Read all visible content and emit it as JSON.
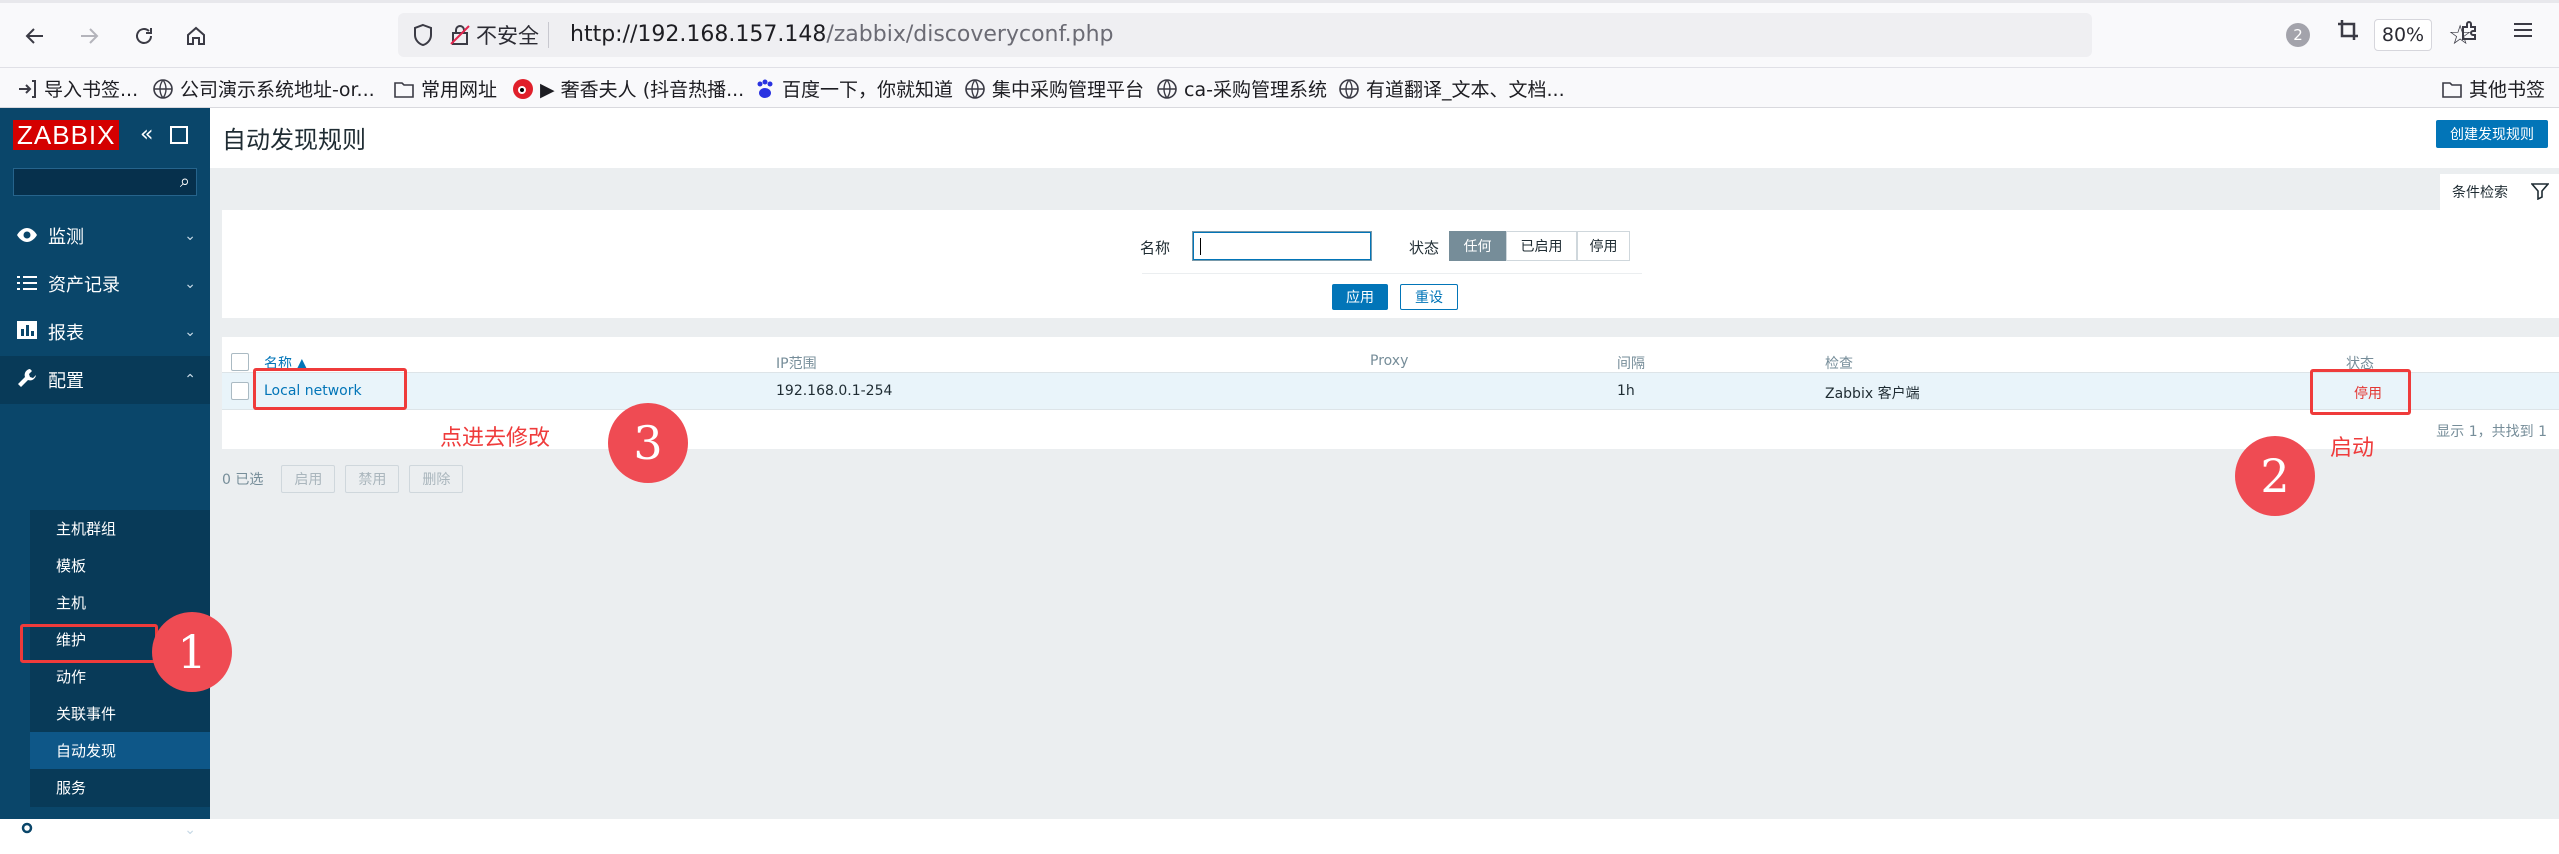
{
  "browser": {
    "security_label": "不安全",
    "url_host": "http://192.168.157.148",
    "url_path": "/zabbix/discoveryconf.php",
    "zoom": "80%",
    "notification_count": "2",
    "bookmarks": [
      "导入书签...",
      "公司演示系统地址-or...",
      "常用网址",
      "▶ 奢香夫人 (抖音热播...",
      "百度一下，你就知道",
      "集中采购管理平台",
      "ca-采购管理系统",
      "有道翻译_文本、文档...",
      "其他书签"
    ]
  },
  "sidebar": {
    "logo": "ZABBIX",
    "menu": [
      {
        "label": "监测",
        "icon": "eye-icon"
      },
      {
        "label": "资产记录",
        "icon": "list-icon"
      },
      {
        "label": "报表",
        "icon": "bar-chart-icon"
      },
      {
        "label": "配置",
        "icon": "wrench-icon"
      },
      {
        "label": "管理",
        "icon": "gear-icon"
      }
    ],
    "config_submenu": [
      "主机群组",
      "模板",
      "主机",
      "维护",
      "动作",
      "关联事件",
      "自动发现",
      "服务"
    ]
  },
  "page": {
    "title": "自动发现规则",
    "create_button": "创建发现规则",
    "filter_tab": "条件检索"
  },
  "filter": {
    "name_label": "名称",
    "name_value": "",
    "status_label": "状态",
    "status_options": [
      "任何",
      "已启用",
      "停用"
    ],
    "status_selected": "任何",
    "apply": "应用",
    "reset": "重设"
  },
  "table": {
    "headers": {
      "name": "名称 ▲",
      "ip": "IP范围",
      "proxy": "Proxy",
      "interval": "间隔",
      "checks": "检查",
      "status": "状态"
    },
    "rows": [
      {
        "name": "Local network",
        "ip": "192.168.0.1-254",
        "proxy": "",
        "interval": "1h",
        "checks": "Zabbix 客户端",
        "status": "停用"
      }
    ],
    "footer": "显示 1，共找到 1"
  },
  "mass_actions": {
    "selected": "0 已选",
    "enable": "启用",
    "disable": "禁用",
    "delete": "删除"
  },
  "annotations": {
    "n1": "1",
    "n2": "2",
    "n3": "3",
    "text_enable": "启动",
    "text_edit": "点进去修改"
  },
  "colors": {
    "zabbix_sidebar": "#0a466a",
    "zabbix_blue": "#0275b8",
    "annotation_red": "#ef3b3b",
    "status_disabled_red": "#e33734"
  }
}
